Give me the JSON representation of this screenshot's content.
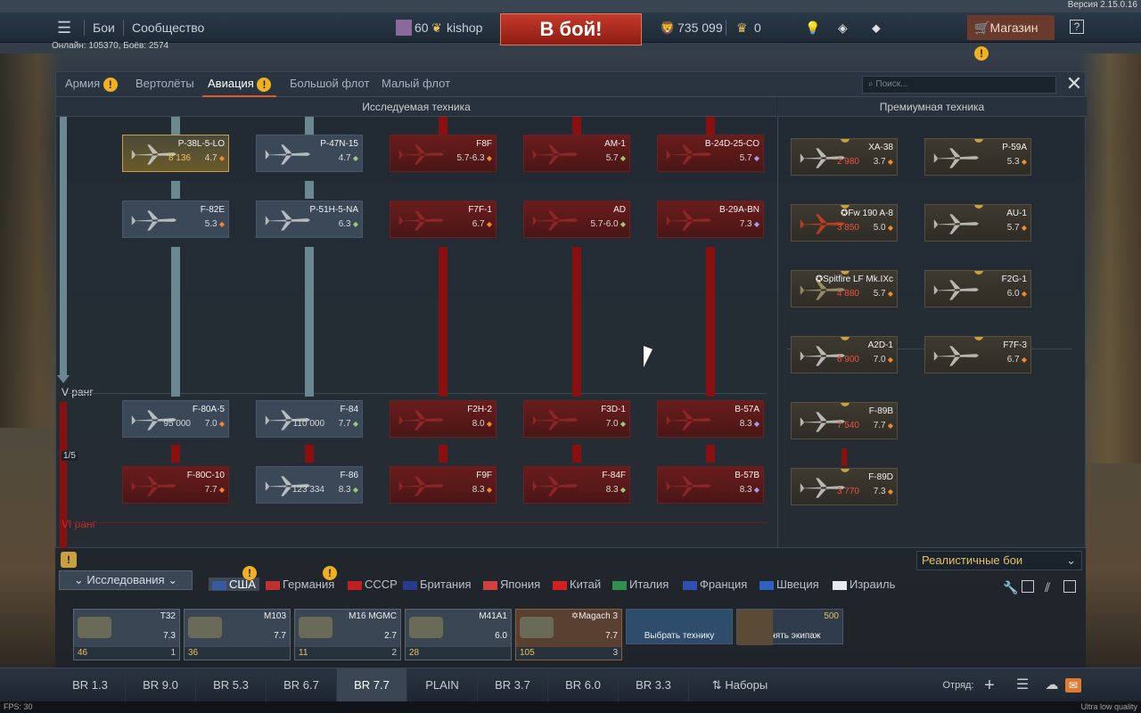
{
  "version": "Версия 2.15.0.16",
  "topbar": {
    "battles": "Бои",
    "community": "Сообщество",
    "level": "60",
    "username": "kishop",
    "to_battle": "В бой!",
    "silver": "735 099",
    "gold": "0",
    "shop": "Магазин"
  },
  "online": "Онлайн: 105370, Боёв: 2574",
  "tabs": [
    {
      "label": "Армия",
      "warn": true
    },
    {
      "label": "Вертолёты",
      "warn": false
    },
    {
      "label": "Авиация",
      "warn": true,
      "active": true
    },
    {
      "label": "Большой флот",
      "warn": false
    },
    {
      "label": "Малый флот",
      "warn": false
    }
  ],
  "search_placeholder": "Поиск...",
  "section_researchable": "Исследуемая техника",
  "section_premium": "Премиумная техника",
  "rank_v": "V ранг",
  "rank_vi": "VI ранг",
  "page_indicator": "1/5",
  "tree_cards": [
    {
      "name": "P-38L-5-LO",
      "br": "4.7",
      "cost": "8 136",
      "style": "gold"
    },
    {
      "name": "P-47N-15",
      "br": "4.7",
      "style": "normal"
    },
    {
      "name": "F8F",
      "br": "5.7-6.3",
      "style": "red"
    },
    {
      "name": "AM-1",
      "br": "5.7",
      "style": "red"
    },
    {
      "name": "B-24D-25-CO",
      "br": "5.7",
      "style": "red"
    },
    {
      "name": "F-82E",
      "br": "5.3",
      "style": "normal"
    },
    {
      "name": "P-51H-5-NA",
      "br": "6.3",
      "style": "normal"
    },
    {
      "name": "F7F-1",
      "br": "6.7",
      "style": "red"
    },
    {
      "name": "AD",
      "br": "5.7-6.0",
      "style": "red"
    },
    {
      "name": "B-29A-BN",
      "br": "7.3",
      "style": "red"
    },
    {
      "name": "F-80A-5",
      "br": "7.0",
      "cost": "95 000",
      "style": "normal"
    },
    {
      "name": "F-84",
      "br": "7.7",
      "cost": "110 000",
      "style": "normal"
    },
    {
      "name": "F2H-2",
      "br": "8.0",
      "style": "red"
    },
    {
      "name": "F3D-1",
      "br": "7.0",
      "style": "red"
    },
    {
      "name": "B-57A",
      "br": "8.3",
      "style": "red"
    },
    {
      "name": "F-80C-10",
      "br": "7.7",
      "style": "red"
    },
    {
      "name": "F-86",
      "br": "8.3",
      "cost": "123 334",
      "style": "normal"
    },
    {
      "name": "F9F",
      "br": "8.3",
      "style": "red"
    },
    {
      "name": "F-84F",
      "br": "8.3",
      "style": "red"
    },
    {
      "name": "B-57B",
      "br": "8.3",
      "style": "red"
    }
  ],
  "premium_cards": [
    {
      "name": "XA-38",
      "br": "3.7",
      "cost": "2 980"
    },
    {
      "name": "P-59A",
      "br": "5.3"
    },
    {
      "name": "✪Fw 190 A-8",
      "br": "5.0",
      "cost": "3 850"
    },
    {
      "name": "AU-1",
      "br": "5.7"
    },
    {
      "name": "✪Spitfire LF Mk.IXc",
      "br": "5.7",
      "cost": "4 880"
    },
    {
      "name": "F2G-1",
      "br": "6.0"
    },
    {
      "name": "A2D-1",
      "br": "7.0",
      "cost": "6 900"
    },
    {
      "name": "F7F-3",
      "br": "6.7"
    },
    {
      "name": "F-89B",
      "br": "7.7",
      "cost": "7 540"
    },
    {
      "name": "F-89D",
      "br": "7.3",
      "cost": "3 770"
    }
  ],
  "research_label": "Исследования",
  "nations": [
    "США",
    "Германия",
    "СССР",
    "Британия",
    "Япония",
    "Китай",
    "Италия",
    "Франция",
    "Швеция",
    "Израиль"
  ],
  "game_mode": "Реалистичные бои",
  "crew_slots": [
    {
      "name": "T32",
      "br": "7.3",
      "count": "46",
      "slot": "1"
    },
    {
      "name": "M103",
      "br": "7.7",
      "count": "36",
      "slot": ""
    },
    {
      "name": "M16 MGMC",
      "br": "2.7",
      "count": "11",
      "slot": "2"
    },
    {
      "name": "M41A1",
      "br": "6.0",
      "count": "28",
      "slot": ""
    },
    {
      "name": "✡Magach 3",
      "br": "7.7",
      "count": "105",
      "slot": "3"
    }
  ],
  "choose_vehicle": "Выбрать технику",
  "hire_crew": "Нанять экипаж",
  "hire_cost": "500",
  "br_list": [
    "BR 1.3",
    "BR 9.0",
    "BR 5.3",
    "BR 6.7",
    "BR 7.7",
    "PLAIN",
    "BR 3.7",
    "BR 6.0",
    "BR 3.3"
  ],
  "presets": "Наборы",
  "squad": "Отряд:",
  "fps": "FPS: 30",
  "quality": "Ultra low quality"
}
